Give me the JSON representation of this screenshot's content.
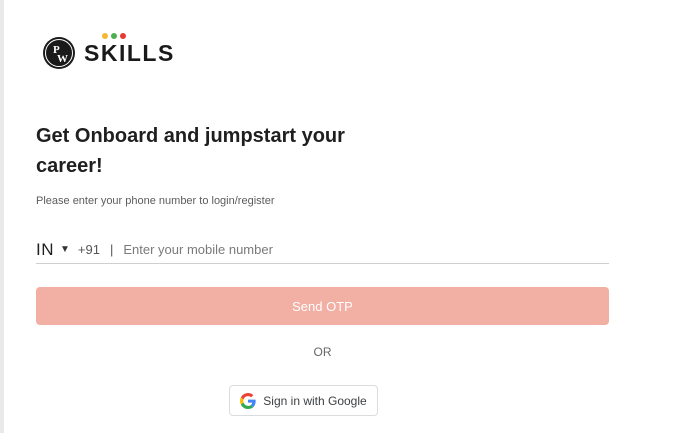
{
  "brand": {
    "name": "SKILLS",
    "dot_colors": [
      "#f5b731",
      "#4caf50",
      "#e53935"
    ]
  },
  "login": {
    "headline": "Get Onboard and jumpstart your career!",
    "subtext": "Please enter your phone number to login/register",
    "country_code": "IN",
    "dial_code": "+91",
    "separator": "|",
    "phone_placeholder": "Enter your mobile number",
    "send_otp_label": "Send OTP",
    "or_label": "OR",
    "google_label": "Sign in with Google"
  },
  "colors": {
    "otp_button_bg": "#f2afa3",
    "text_primary": "#1f1f1f"
  }
}
